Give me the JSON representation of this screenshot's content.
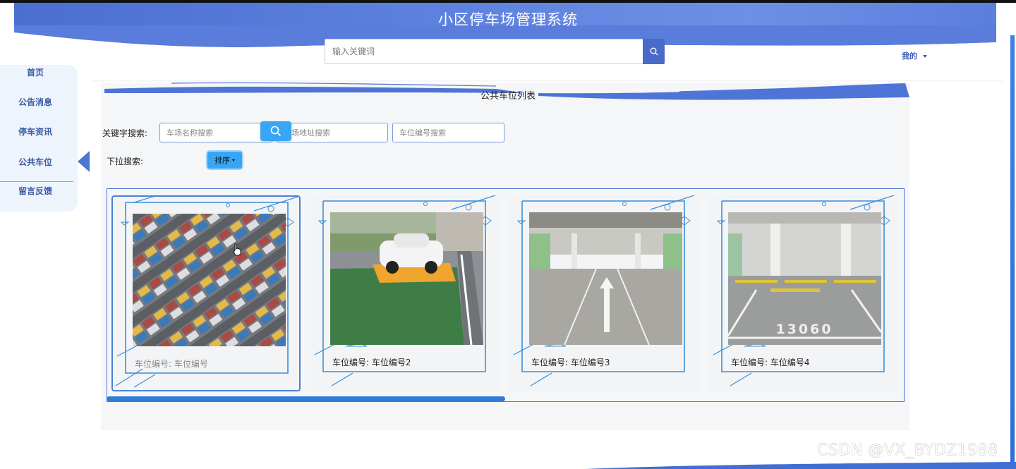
{
  "header": {
    "title": "小区停车场管理系统",
    "search_placeholder": "输入关键词",
    "user_menu_label": "我的"
  },
  "sidebar": {
    "items": [
      {
        "label": "首页"
      },
      {
        "label": "公告消息"
      },
      {
        "label": "停车资讯"
      },
      {
        "label": "公共车位",
        "active": true
      },
      {
        "label": "留言反馈"
      }
    ]
  },
  "content": {
    "title": "公共车位列表",
    "keyword_label": "关键字搜索:",
    "filters": {
      "lot_name_placeholder": "车场名称搜索",
      "lot_address_placeholder": "场地址搜索",
      "space_number_placeholder": "车位编号搜索"
    },
    "dropdown_label": "下拉搜索:",
    "sort_label": "排序"
  },
  "cards": [
    {
      "label": "车位编号: 车位编号",
      "icon": "aerial-parking-lot-photo"
    },
    {
      "label": "车位编号: 车位编号2",
      "icon": "white-car-green-space-photo"
    },
    {
      "label": "车位编号: 车位编号3",
      "icon": "underground-garage-arrow-photo"
    },
    {
      "label": "车位编号: 车位编号4",
      "icon": "garage-space-13060-photo"
    }
  ],
  "photo_texts": {
    "card4_floor_number": "13060"
  },
  "watermark": "CSDN @VX_BYDZ1988",
  "colors": {
    "brand_blue": "#4a6fd0",
    "accent_blue": "#38a6f5",
    "underline_orange": "#e88b5a"
  }
}
